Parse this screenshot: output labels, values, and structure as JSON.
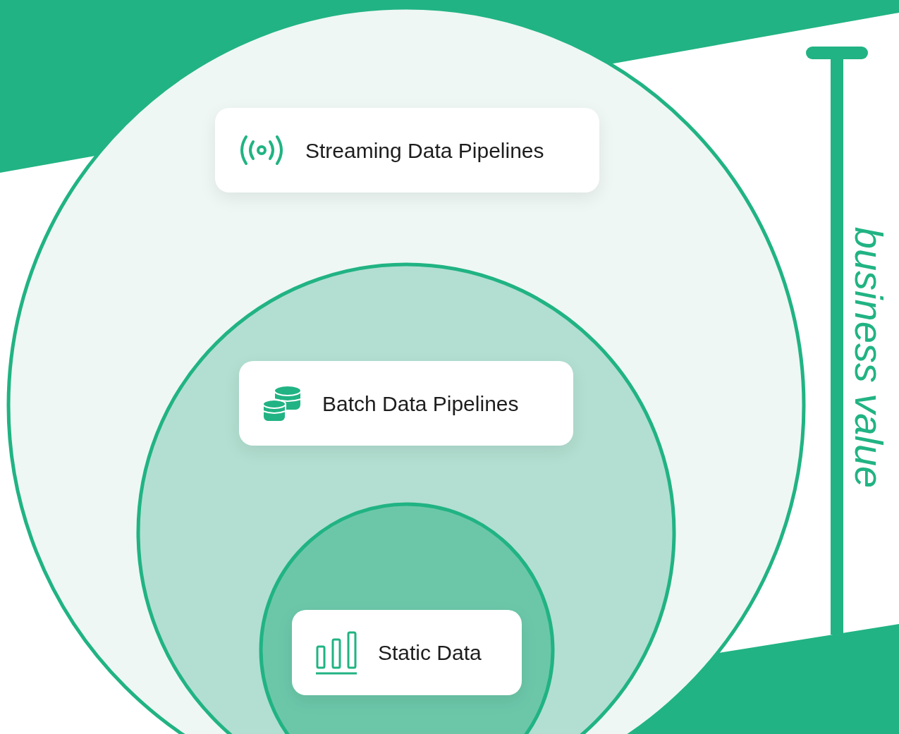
{
  "levels": [
    {
      "label": "Streaming Data Pipelines",
      "kind": "streaming"
    },
    {
      "label": "Batch Data Pipelines",
      "kind": "batch"
    },
    {
      "label": "Static Data",
      "kind": "static"
    }
  ],
  "axis_label": "business value"
}
